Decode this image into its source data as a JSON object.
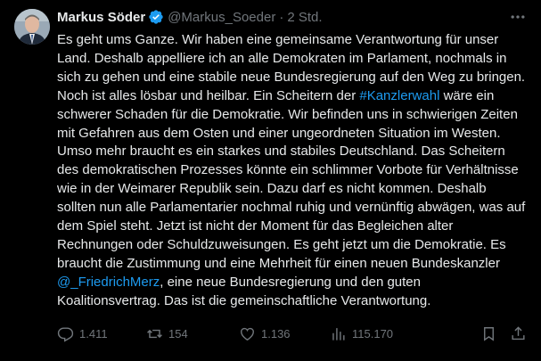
{
  "author": {
    "name": "Markus Söder",
    "handle": "@Markus_Soeder",
    "separator": "·",
    "time": "2 Std."
  },
  "tweet": {
    "text_part1": "Es geht ums Ganze. Wir haben eine gemeinsame Verantwortung für unser Land. Deshalb appelliere ich an alle Demokraten im Parlament, nochmals in sich zu gehen und eine stabile neue Bundesregierung auf den Weg zu bringen. Noch ist alles lösbar und heilbar. Ein Scheitern der ",
    "hashtag": "#Kanzlerwahl",
    "text_part2": " wäre ein schwerer Schaden für die Demokratie. Wir befinden uns in schwierigen Zeiten mit Gefahren aus dem Osten und einer ungeordneten Situation im Westen. Umso mehr braucht es ein starkes und stabiles Deutschland. Das Scheitern des demokratischen Prozesses könnte ein schlimmer Vorbote für Verhältnisse wie in der Weimarer Republik sein. Dazu darf es nicht kommen. Deshalb sollten nun alle Parlamentarier nochmal ruhig und vernünftig abwägen, was auf dem Spiel steht. Jetzt ist nicht der Moment für das Begleichen alter Rechnungen oder Schuldzuweisungen. Es geht jetzt um die Demokratie. Es braucht die Zustimmung und eine Mehrheit für einen neuen Bundeskanzler ",
    "mention": "@_FriedrichMerz",
    "text_part3": ", eine neue Bundesregierung und den guten Koalitionsvertrag. Das ist die gemeinschaftliche Verantwortung."
  },
  "actions": {
    "replies": "1.411",
    "retweets": "154",
    "likes": "1.136",
    "views": "115.170"
  },
  "colors": {
    "background": "#000000",
    "text": "#e7e9ea",
    "muted": "#71767b",
    "link": "#1d9bf0",
    "verified": "#1d9bf0"
  },
  "icons": [
    "verified-badge-icon",
    "more-icon",
    "reply-icon",
    "retweet-icon",
    "like-icon",
    "views-icon",
    "bookmark-icon",
    "share-icon"
  ]
}
